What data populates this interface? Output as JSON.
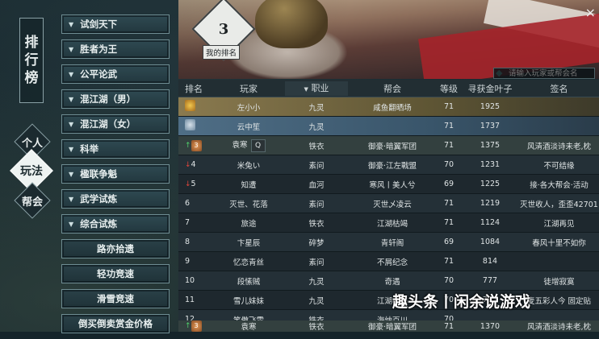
{
  "sidebar_title": [
    "排",
    "行",
    "榜"
  ],
  "tabs": {
    "personal": "个人",
    "gameplay": "玩法",
    "guild": "帮会"
  },
  "menu": [
    {
      "label": "试剑天下",
      "chevron": true
    },
    {
      "label": "胜者为王",
      "chevron": true
    },
    {
      "label": "公平论武",
      "chevron": true
    },
    {
      "label": "混江湖（男）",
      "chevron": true
    },
    {
      "label": "混江湖（女）",
      "chevron": true
    },
    {
      "label": "科举",
      "chevron": true
    },
    {
      "label": "楹联争魁",
      "chevron": true
    },
    {
      "label": "武学试炼",
      "chevron": true
    },
    {
      "label": "综合试炼",
      "chevron": true
    },
    {
      "label": "路亦拾遗",
      "chevron": false
    },
    {
      "label": "轻功竞速",
      "chevron": false
    },
    {
      "label": "滑雪竞速",
      "chevron": false
    },
    {
      "label": "倒买倒卖赏金价格",
      "chevron": false
    }
  ],
  "banner": {
    "my_rank": "3",
    "my_rank_label": "我的排名",
    "close": "×"
  },
  "search": {
    "placeholder": "请输入玩家或帮会名"
  },
  "columns": {
    "rank": "排名",
    "player": "玩家",
    "class": "职业",
    "guild": "帮会",
    "level": "等级",
    "gold": "寻获金叶子",
    "signature": "签名",
    "sort_indicator": "▼"
  },
  "rows": [
    {
      "rank": "",
      "player": "左小小",
      "class": "九灵",
      "guild": "咸鱼翻晒场",
      "level": "71",
      "gold": "1925",
      "signature": "",
      "style": "gold",
      "medal": "g",
      "trend": ""
    },
    {
      "rank": "",
      "player": "云中笙",
      "class": "九灵",
      "guild": "",
      "level": "71",
      "gold": "1737",
      "signature": "",
      "style": "silver",
      "medal": "s",
      "trend": ""
    },
    {
      "rank": "3",
      "player": "袁寒",
      "class": "铁衣",
      "guild": "御豪·暗翼军团",
      "level": "71",
      "gold": "1375",
      "signature": "风清酒淡诗未老,枕",
      "style": "mine",
      "medal": "b",
      "trend": "up"
    },
    {
      "rank": "4",
      "player": "米兔い",
      "class": "素问",
      "guild": "御豪·江左戰盟",
      "level": "70",
      "gold": "1231",
      "signature": "不可结缘",
      "style": "",
      "medal": "",
      "trend": "down"
    },
    {
      "rank": "5",
      "player": "知遭",
      "class": "血河",
      "guild": "寒风丨美人兮",
      "level": "69",
      "gold": "1225",
      "signature": "接·各大帮会·活动",
      "style": "",
      "medal": "",
      "trend": "down"
    },
    {
      "rank": "6",
      "player": "灭世、花落",
      "class": "素问",
      "guild": "灭世乄凌云",
      "level": "71",
      "gold": "1219",
      "signature": "灭世收人，歪歪42701",
      "style": "",
      "medal": "",
      "trend": ""
    },
    {
      "rank": "7",
      "player": "旅途",
      "class": "铁衣",
      "guild": "江湖枯竭",
      "level": "71",
      "gold": "1124",
      "signature": "江湖再见",
      "style": "",
      "medal": "",
      "trend": ""
    },
    {
      "rank": "8",
      "player": "卞星辰",
      "class": "碎梦",
      "guild": "青轩阁",
      "level": "69",
      "gold": "1084",
      "signature": "春风十里不如你",
      "style": "",
      "medal": "",
      "trend": ""
    },
    {
      "rank": "9",
      "player": "忆恋青丝",
      "class": "素问",
      "guild": "不屑纪念",
      "level": "71",
      "gold": "814",
      "signature": "",
      "style": "",
      "medal": "",
      "trend": ""
    },
    {
      "rank": "10",
      "player": "段愫贼",
      "class": "九灵",
      "guild": "奇遇",
      "level": "70",
      "gold": "777",
      "signature": "徒增寂寞",
      "style": "",
      "medal": "",
      "trend": ""
    },
    {
      "rank": "11",
      "player": "雪儿妹妹",
      "class": "九灵",
      "guild": "江湖枯竭",
      "level": "70",
      "gold": "777",
      "signature": "麦五彩人今 固定贴",
      "style": "",
      "medal": "",
      "trend": ""
    },
    {
      "rank": "12",
      "player": "笑傲飞雪",
      "class": "铁衣",
      "guild": "海纳百川",
      "level": "70",
      "gold": "",
      "signature": "",
      "style": "",
      "medal": "",
      "trend": ""
    }
  ],
  "my_row": {
    "rank": "3",
    "player": "袁寒",
    "class": "铁衣",
    "guild": "御豪·暗翼军团",
    "level": "71",
    "gold": "1370",
    "signature": "风清酒淡诗未老,枕"
  },
  "watermark": "趣头条丨闲余说游戏"
}
